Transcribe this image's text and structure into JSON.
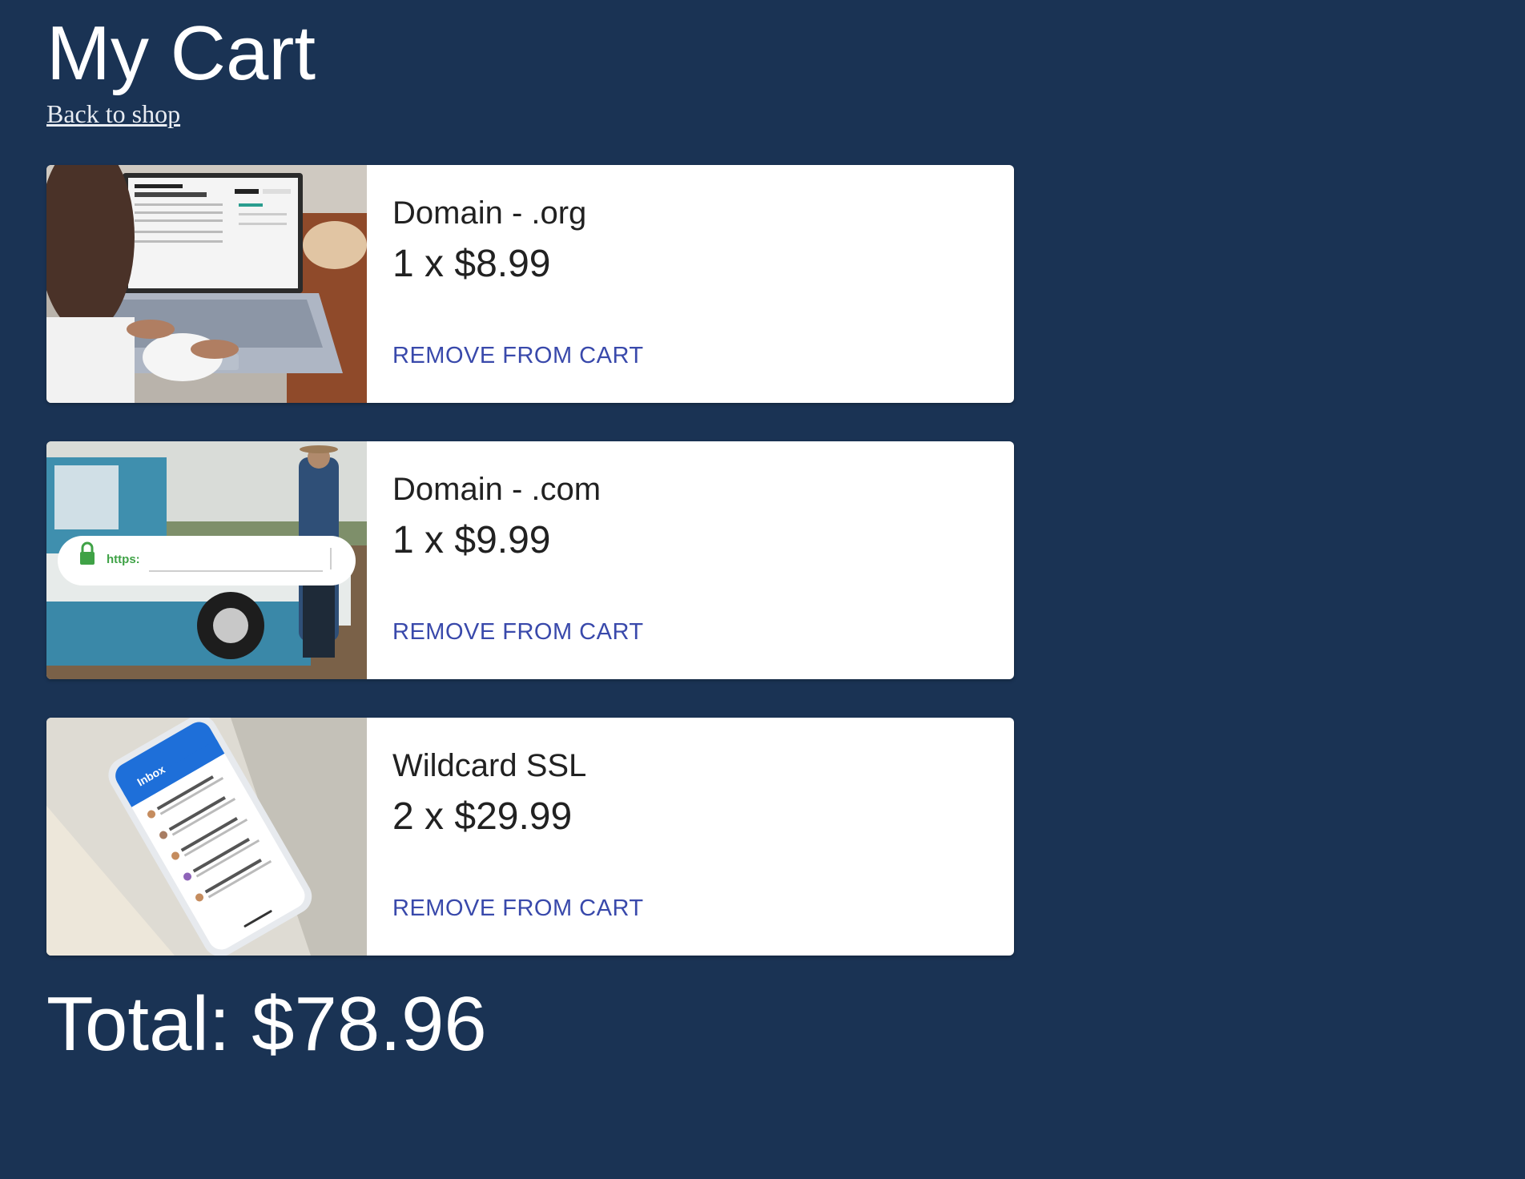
{
  "page": {
    "title": "My Cart",
    "back_link": "Back to shop"
  },
  "cart": {
    "items": [
      {
        "name": "Domain - .org",
        "price_line": "1 x $8.99",
        "remove_label": "REMOVE FROM CART",
        "image": "laptop-photo"
      },
      {
        "name": "Domain - .com",
        "price_line": "1 x $9.99",
        "remove_label": "REMOVE FROM CART",
        "image": "truck-photo",
        "image_overlay_text": "https:"
      },
      {
        "name": "Wildcard SSL",
        "price_line": "2 x $29.99",
        "remove_label": "REMOVE FROM CART",
        "image": "phone-photo",
        "image_overlay_text": "Inbox"
      }
    ],
    "total": "Total: $78.96"
  },
  "colors": {
    "background": "#1a3354",
    "card": "#ffffff",
    "action": "#3949ab"
  }
}
